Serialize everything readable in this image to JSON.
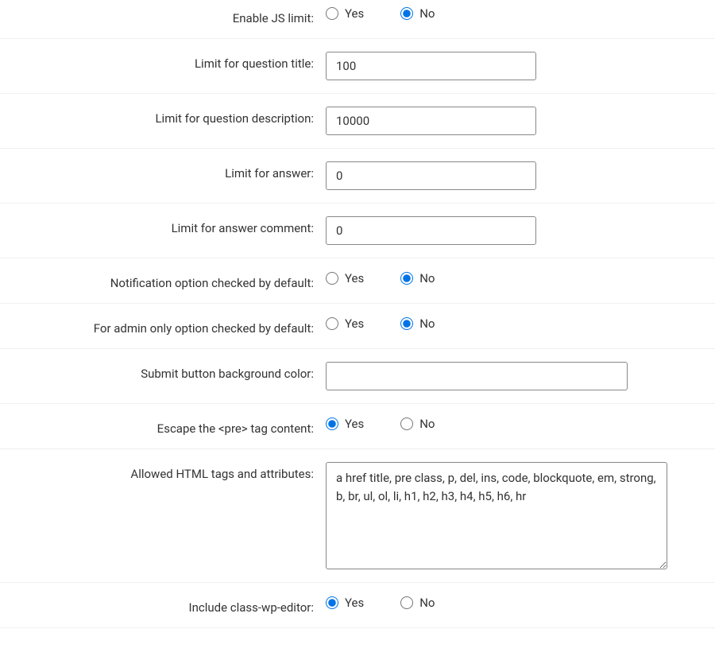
{
  "options": {
    "yes": "Yes",
    "no": "No"
  },
  "rows": [
    {
      "id": "enable-js-limit",
      "label": "Enable JS limit:",
      "type": "radio",
      "selected": "no"
    },
    {
      "id": "limit-question-title",
      "label": "Limit for question title:",
      "type": "text",
      "value": "100"
    },
    {
      "id": "limit-question-description",
      "label": "Limit for question description:",
      "type": "text",
      "value": "10000"
    },
    {
      "id": "limit-answer",
      "label": "Limit for answer:",
      "type": "text",
      "value": "0"
    },
    {
      "id": "limit-answer-comment",
      "label": "Limit for answer comment:",
      "type": "text",
      "value": "0"
    },
    {
      "id": "notification-default",
      "label": "Notification option checked by default:",
      "type": "radio",
      "selected": "no"
    },
    {
      "id": "admin-only-default",
      "label": "For admin only option checked by default:",
      "type": "radio",
      "selected": "no"
    },
    {
      "id": "submit-bg-color",
      "label": "Submit button background color:",
      "type": "text-wide",
      "value": ""
    },
    {
      "id": "escape-pre",
      "label": "Escape the <pre> tag content:",
      "type": "radio",
      "selected": "yes"
    },
    {
      "id": "allowed-html",
      "label": "Allowed HTML tags and attributes:",
      "type": "textarea",
      "value": "a href title, pre class, p, del, ins, code, blockquote, em, strong, b, br, ul, ol, li, h1, h2, h3, h4, h5, h6, hr"
    },
    {
      "id": "include-wp-editor",
      "label": "Include class-wp-editor:",
      "type": "radio",
      "selected": "yes"
    }
  ]
}
